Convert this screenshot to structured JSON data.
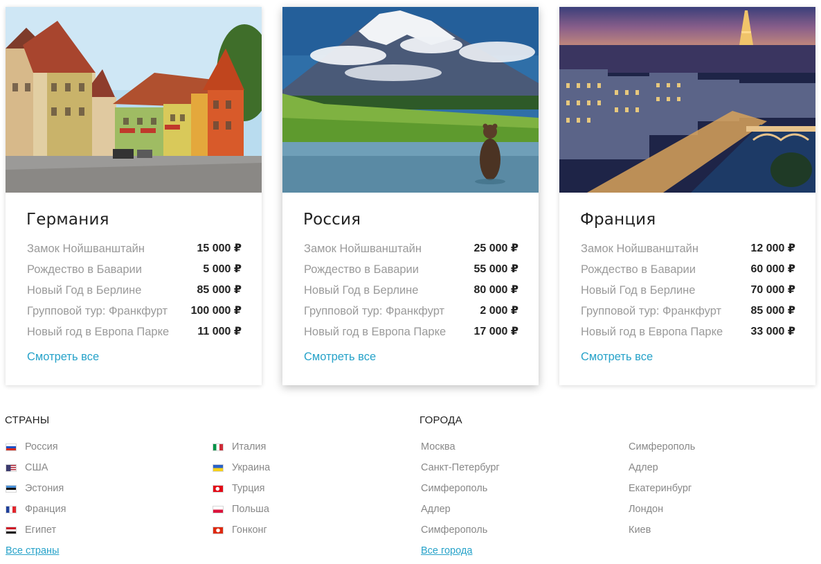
{
  "cards": [
    {
      "title": "Германия",
      "photo": "germany-old-town-photo",
      "tours": [
        {
          "name": "Замок Нойшванштайн",
          "price": "15 000 ₽"
        },
        {
          "name": "Рождество в Баварии",
          "price": "5 000 ₽"
        },
        {
          "name": "Новый Год в Берлине",
          "price": "85 000 ₽"
        },
        {
          "name": "Групповой тур: Франкфурт",
          "price": "100 000 ₽"
        },
        {
          "name": "Новый год в Европа Парке",
          "price": "11 000 ₽"
        }
      ],
      "see_all": "Смотреть все"
    },
    {
      "title": "Россия",
      "photo": "russia-volcano-bear-photo",
      "tours": [
        {
          "name": "Замок Нойшванштайн",
          "price": "25 000 ₽"
        },
        {
          "name": "Рождество в Баварии",
          "price": "55 000 ₽"
        },
        {
          "name": "Новый Год в Берлине",
          "price": "80 000 ₽"
        },
        {
          "name": "Групповой тур: Франкфурт",
          "price": "2 000 ₽"
        },
        {
          "name": "Новый год в Европа Парке",
          "price": "17 000 ₽"
        }
      ],
      "see_all": "Смотреть все"
    },
    {
      "title": "Франция",
      "photo": "paris-night-photo",
      "tours": [
        {
          "name": "Замок Нойшванштайн",
          "price": "12 000 ₽"
        },
        {
          "name": "Рождество в Баварии",
          "price": "60 000 ₽"
        },
        {
          "name": "Новый Год в Берлине",
          "price": "70 000 ₽"
        },
        {
          "name": "Групповой тур: Франкфурт",
          "price": "85 000 ₽"
        },
        {
          "name": "Новый год в Европа Парке",
          "price": "33 000 ₽"
        }
      ],
      "see_all": "Смотреть все"
    }
  ],
  "countries": {
    "title": "СТРАНЫ",
    "columns": [
      [
        {
          "name": "Россия",
          "flag": "flag-russia-icon"
        },
        {
          "name": "США",
          "flag": "flag-usa-icon"
        },
        {
          "name": "Эстония",
          "flag": "flag-estonia-icon"
        },
        {
          "name": "Франция",
          "flag": "flag-france-icon"
        },
        {
          "name": "Египет",
          "flag": "flag-egypt-icon"
        }
      ],
      [
        {
          "name": "Италия",
          "flag": "flag-italy-icon"
        },
        {
          "name": "Украина",
          "flag": "flag-ukraine-icon"
        },
        {
          "name": "Турция",
          "flag": "flag-turkey-icon"
        },
        {
          "name": "Польша",
          "flag": "flag-poland-icon"
        },
        {
          "name": "Гонконг",
          "flag": "flag-hongkong-icon"
        }
      ]
    ],
    "all_link": "Все страны"
  },
  "cities": {
    "title": "ГОРОДА",
    "columns": [
      [
        "Москва",
        "Санкт-Петербург",
        "Симферополь",
        "Адлер",
        "Симферополь"
      ],
      [
        "Симферополь",
        "Адлер",
        "Екатеринбург",
        "Лондон",
        "Киев"
      ]
    ],
    "all_link": "Все города"
  },
  "colors": {
    "link": "#26a2c9",
    "muted_text": "#9a9a9a",
    "price_text": "#222222"
  }
}
